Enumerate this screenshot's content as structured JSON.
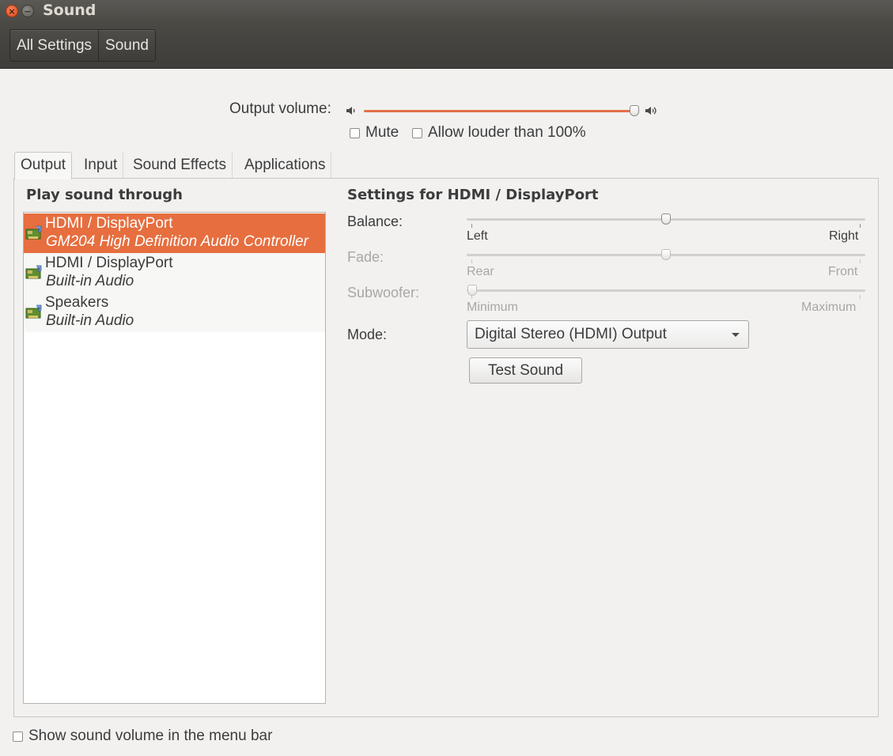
{
  "window": {
    "title": "Sound"
  },
  "breadcrumbs": [
    "All Settings",
    "Sound"
  ],
  "output_volume": {
    "label": "Output volume:",
    "level": 1.0
  },
  "checkboxes": {
    "mute": "Mute",
    "allow_louder": "Allow louder than 100%",
    "show_in_menu": "Show sound volume in the menu bar"
  },
  "tabs": [
    "Output",
    "Input",
    "Sound Effects",
    "Applications"
  ],
  "active_tab": "Output",
  "left_panel": {
    "heading": "Play sound through",
    "devices": [
      {
        "name": "HDMI / DisplayPort",
        "description": "GM204 High Definition Audio Controller",
        "selected": true
      },
      {
        "name": "HDMI / DisplayPort",
        "description": "Built-in Audio",
        "selected": false
      },
      {
        "name": "Speakers",
        "description": "Built-in Audio",
        "selected": false
      }
    ]
  },
  "right_panel": {
    "heading": "Settings for HDMI / DisplayPort",
    "balance": {
      "label": "Balance:",
      "min_label": "Left",
      "max_label": "Right",
      "value": 0.5
    },
    "fade": {
      "label": "Fade:",
      "min_label": "Rear",
      "max_label": "Front",
      "value": 0.5,
      "enabled": false
    },
    "subwoofer": {
      "label": "Subwoofer:",
      "min_label": "Minimum",
      "max_label": "Maximum",
      "value": 0.0,
      "enabled": false
    },
    "mode": {
      "label": "Mode:",
      "value": "Digital Stereo (HDMI) Output"
    },
    "test_button": "Test Sound"
  },
  "colors": {
    "accent": "#e66e3f",
    "slider_fill": "#e27049"
  }
}
